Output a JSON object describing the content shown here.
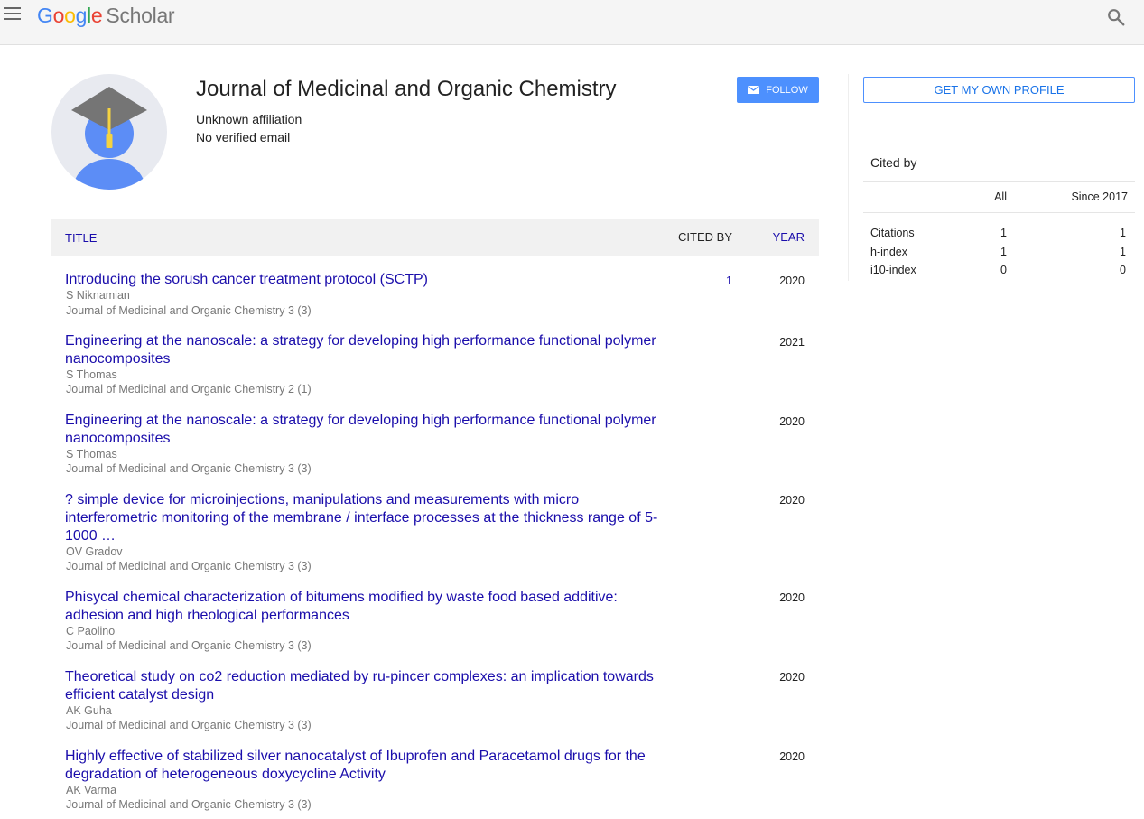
{
  "header": {
    "logo_google": "Google",
    "logo_scholar": "Scholar"
  },
  "profile": {
    "name": "Journal of Medicinal and Organic Chemistry",
    "affiliation": "Unknown affiliation",
    "email": "No verified email",
    "follow_label": "FOLLOW"
  },
  "table": {
    "col_title": "TITLE",
    "col_cited": "CITED BY",
    "col_year": "YEAR",
    "rows": [
      {
        "title": "Introducing the sorush cancer treatment protocol (SCTP)",
        "author": "S Niknamian",
        "source": "Journal of Medicinal and Organic Chemistry 3 (3)",
        "cited": "1",
        "year": "2020"
      },
      {
        "title": "Engineering at the nanoscale: a strategy for developing high performance functional polymer nanocomposites",
        "author": "S Thomas",
        "source": "Journal of Medicinal and Organic Chemistry 2 (1)",
        "cited": "",
        "year": "2021"
      },
      {
        "title": "Engineering at the nanoscale: a strategy for developing high performance functional polymer nanocomposites",
        "author": "S Thomas",
        "source": "Journal of Medicinal and Organic Chemistry 3 (3)",
        "cited": "",
        "year": "2020"
      },
      {
        "title": "? simple device for microinjections, manipulations and measurements with micro interferometric monitoring of the membrane / interface processes at the thickness range of 5-1000 …",
        "author": "OV Gradov",
        "source": "Journal of Medicinal and Organic Chemistry 3 (3)",
        "cited": "",
        "year": "2020"
      },
      {
        "title": "Phisycal chemical characterization of bitumens modified by waste food based additive: adhesion and high rheological performances",
        "author": "C Paolino",
        "source": "Journal of Medicinal and Organic Chemistry 3 (3)",
        "cited": "",
        "year": "2020"
      },
      {
        "title": "Theoretical study on co2 reduction mediated by ru-pincer complexes: an implication towards efficient catalyst design",
        "author": "AK Guha",
        "source": "Journal of Medicinal and Organic Chemistry 3 (3)",
        "cited": "",
        "year": "2020"
      },
      {
        "title": "Highly effective of stabilized silver nanocatalyst of Ibuprofen and Paracetamol drugs for the degradation of heterogeneous doxycycline Activity",
        "author": "AK Varma",
        "source": "Journal of Medicinal and Organic Chemistry 3 (3)",
        "cited": "",
        "year": "2020"
      }
    ]
  },
  "sidebar": {
    "own_profile_label": "GET MY OWN PROFILE",
    "cited_by_title": "Cited by",
    "col_all": "All",
    "col_since": "Since 2017",
    "metrics": [
      {
        "label": "Citations",
        "all": "1",
        "since": "1"
      },
      {
        "label": "h-index",
        "all": "1",
        "since": "1"
      },
      {
        "label": "i10-index",
        "all": "0",
        "since": "0"
      }
    ]
  },
  "colors": {
    "link": "#1a0dab",
    "accent": "#4d90fe",
    "avatar_bg": "#e8eaf0",
    "avatar_person": "#5c8df6",
    "cap": "#757575",
    "tassel": "#f5d341"
  }
}
